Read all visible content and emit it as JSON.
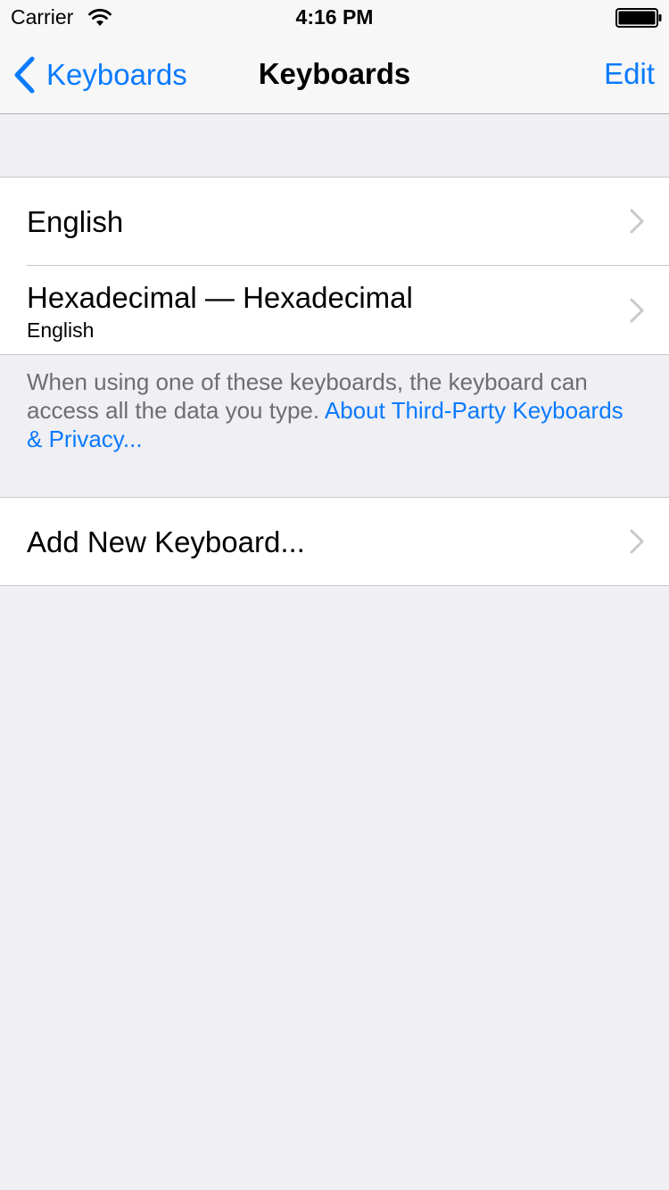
{
  "status_bar": {
    "carrier": "Carrier",
    "time": "4:16 PM"
  },
  "nav": {
    "back_label": "Keyboards",
    "title": "Keyboards",
    "edit_label": "Edit"
  },
  "keyboards": [
    {
      "title": "English",
      "subtitle": ""
    },
    {
      "title": "Hexadecimal — Hexadecimal",
      "subtitle": "English"
    }
  ],
  "footer": {
    "text": "When using one of these keyboards, the keyboard can access all the data you type. ",
    "link": "About Third-Party Keyboards & Privacy..."
  },
  "add_keyboard": {
    "label": "Add New Keyboard..."
  },
  "colors": {
    "accent": "#0a7aff",
    "background": "#efeff4",
    "separator": "#c8c7cc",
    "secondary_text": "#6d6d72"
  }
}
